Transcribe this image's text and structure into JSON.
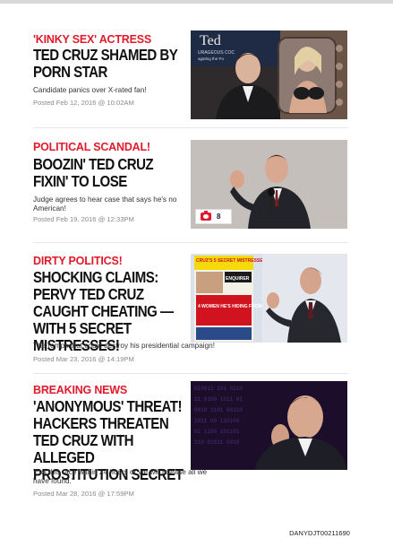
{
  "articles": [
    {
      "kicker": "'KINKY SEX' ACTRESS",
      "headline": "TED CRUZ SHAMED BY PORN STAR",
      "dek": "Candidate panics over X-rated fan!",
      "posted": "Posted Feb 12, 2016 @ 10:02AM",
      "image_text": "Ted",
      "image_subtext": "URAGEOUS COC\nagating the Po"
    },
    {
      "kicker": "POLITICAL SCANDAL!",
      "headline": "BOOZIN' TED CRUZ FIXIN' TO LOSE",
      "dek": "Judge agrees to hear case that says he's no American!",
      "posted": "Posted Feb 19, 2016 @ 12:33PM",
      "gallery_count": "8"
    },
    {
      "kicker": "DIRTY POLITICS!",
      "headline": "SHOCKING CLAIMS: PERVY TED CRUZ CAUGHT CHEATING — WITH 5 SECRET MISTRESSES!",
      "dek": "The romps that could destroy his presidential campaign!",
      "posted": "Posted Mar 23, 2016 @ 14:19PM",
      "cover_lines": [
        "CRUZ'S 5 SECRET MISTRESSES",
        "ENQUIRER",
        "4 WOMEN HE'S HIDING FROM GWEN!"
      ]
    },
    {
      "kicker": "BREAKING NEWS",
      "headline": "'ANONYMOUS' THREAT! HACKERS THREATEN TED CRUZ WITH ALLEGED PROSTITUTION SECRET",
      "dek": "'Exit this race within 24 hours or we will release all we have found.'",
      "posted": "Posted Mar 28, 2016 @ 17:59PM"
    }
  ],
  "footer_code": "DANYDJT00211690",
  "colors": {
    "kicker": "#e11a2b",
    "headline": "#111111",
    "posted": "#8a8a8a"
  }
}
